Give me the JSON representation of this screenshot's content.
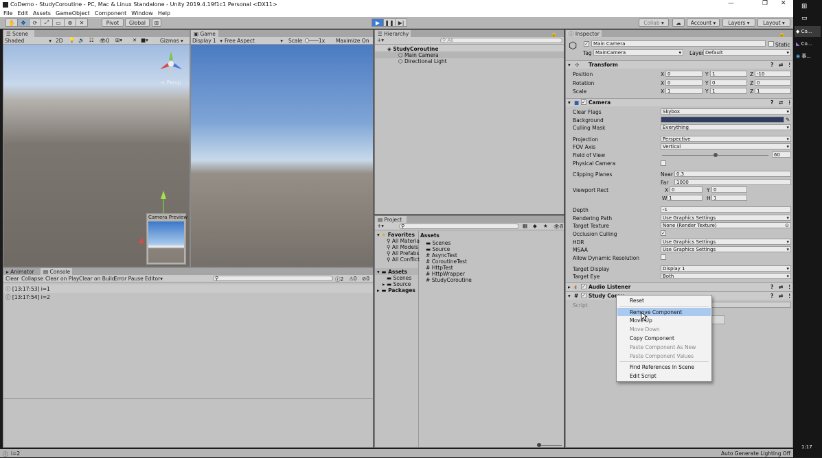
{
  "title": "CoDemo - StudyCoroutine - PC, Mac & Linux Standalone - Unity 2019.4.19f1c1 Personal <DX11>",
  "menu": [
    "File",
    "Edit",
    "Assets",
    "GameObject",
    "Component",
    "Window",
    "Help"
  ],
  "toolbar": {
    "pivot": "Pivot",
    "global": "Global",
    "collab": "Collab",
    "account": "Account",
    "layers": "Layers",
    "layout": "Layout"
  },
  "scene": {
    "tab": "Scene",
    "shading": "Shaded",
    "mode2d": "2D",
    "gizmos": "Gizmos",
    "persp": "< Persp",
    "fx_count": "0",
    "camera_preview": "Camera Preview"
  },
  "game": {
    "tab": "Game",
    "display": "Display 1",
    "aspect": "Free Aspect",
    "scale_label": "Scale",
    "scale_value": "1x",
    "maximize": "Maximize On Pla"
  },
  "console": {
    "tabs": [
      "Animator",
      "Console"
    ],
    "buttons": [
      "Clear",
      "Collapse",
      "Clear on Play",
      "Clear on Build",
      "Error Pause",
      "Editor"
    ],
    "counts": {
      "log": "2",
      "warn": "0",
      "error": "0"
    },
    "logs": [
      "[13:17:53] i=1",
      "[13:17:54] i=2"
    ]
  },
  "hierarchy": {
    "tab": "Hierarchy",
    "search_placeholder": "All",
    "scene": "StudyCoroutine",
    "items": [
      "Main Camera",
      "Directional Light"
    ]
  },
  "project": {
    "tab": "Project",
    "favorites_label": "Favorites",
    "favorites": [
      "All Materia",
      "All Models",
      "All Prefabs",
      "All Conflict"
    ],
    "assets_label": "Assets",
    "tree_assets": [
      "Scenes",
      "Source"
    ],
    "packages_label": "Packages",
    "assets_header": "Assets",
    "files": [
      "Scenes",
      "Source",
      "AsyncTest",
      "CoroutineTest",
      "HttpTest",
      "HttpWrapper",
      "StudyCoroutine"
    ],
    "hidden_count": "8"
  },
  "inspector": {
    "tab": "Inspector",
    "object_name": "Main Camera",
    "static_label": "Static",
    "tag_label": "Tag",
    "tag": "MainCamera",
    "layer_label": "Layer",
    "layer": "Default",
    "transform": {
      "header": "Transform",
      "position_label": "Position",
      "position": {
        "x": "0",
        "y": "1",
        "z": "-10"
      },
      "rotation_label": "Rotation",
      "rotation": {
        "x": "0",
        "y": "0",
        "z": "0"
      },
      "scale_label": "Scale",
      "scale": {
        "x": "1",
        "y": "1",
        "z": "1"
      }
    },
    "camera": {
      "header": "Camera",
      "clear_flags_label": "Clear Flags",
      "clear_flags": "Skybox",
      "background_label": "Background",
      "background_color": "#2e3c61",
      "culling_label": "Culling Mask",
      "culling": "Everything",
      "projection_label": "Projection",
      "projection": "Perspective",
      "fov_axis_label": "FOV Axis",
      "fov_axis": "Vertical",
      "fov_label": "Field of View",
      "fov": "60",
      "fov_fraction": 0.5,
      "physical_label": "Physical Camera",
      "clipping_label": "Clipping Planes",
      "near_label": "Near",
      "near": "0.3",
      "far_label": "Far",
      "far": "1000",
      "viewport_label": "Viewport Rect",
      "vp": {
        "x": "0",
        "y": "0",
        "w": "1",
        "h": "1"
      },
      "depth_label": "Depth",
      "depth": "-1",
      "rendering_path_label": "Rendering Path",
      "rendering_path": "Use Graphics Settings",
      "target_texture_label": "Target Texture",
      "target_texture": "None (Render Texture)",
      "occlusion_label": "Occlusion Culling",
      "hdr_label": "HDR",
      "hdr": "Use Graphics Settings",
      "msaa_label": "MSAA",
      "msaa": "Use Graphics Settings",
      "dyn_res_label": "Allow Dynamic Resolution",
      "target_display_label": "Target Display",
      "target_display": "Display 1",
      "target_eye_label": "Target Eye",
      "target_eye": "Both"
    },
    "audio_listener": "Audio Listener",
    "study_coroutine": "Study Corou",
    "script_label": "Script"
  },
  "context_menu": [
    "Reset",
    "Remove Component",
    "Move Up",
    "Move Down",
    "Copy Component",
    "Paste Component As New",
    "Paste Component Values",
    "Find References In Scene",
    "Edit Script"
  ],
  "status": {
    "left": "i=2",
    "right": "Auto Generate Lighting Off"
  },
  "taskbar": {
    "items": [
      "Co...",
      "Co...",
      "事..."
    ],
    "time": "1:17"
  }
}
